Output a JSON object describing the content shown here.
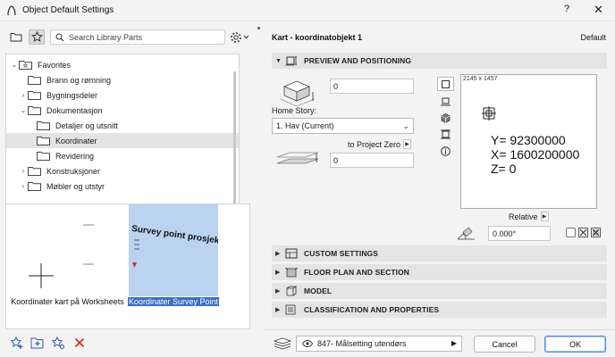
{
  "window": {
    "title": "Object Default Settings",
    "help": "?",
    "close": "✕"
  },
  "library": {
    "search_placeholder": "Search Library Parts",
    "tree": [
      {
        "label": "Favorites",
        "level": 0,
        "expanded": true,
        "type": "favorites"
      },
      {
        "label": "Brann og rømning",
        "level": 1,
        "expanded": false,
        "has_children": false
      },
      {
        "label": "Bygningsdeler",
        "level": 1,
        "expanded": false,
        "has_children": true
      },
      {
        "label": "Dokumentasjon",
        "level": 1,
        "expanded": true,
        "has_children": true
      },
      {
        "label": "Detaljer og utsnitt",
        "level": 2,
        "has_children": false
      },
      {
        "label": "Koordinater",
        "level": 2,
        "has_children": false,
        "selected": true
      },
      {
        "label": "Revidering",
        "level": 2,
        "has_children": false
      },
      {
        "label": "Konstruksjoner",
        "level": 1,
        "expanded": false,
        "has_children": true
      },
      {
        "label": "Møbler og utstyr",
        "level": 1,
        "expanded": false,
        "has_children": true
      }
    ],
    "items": [
      {
        "caption": "Koordinater kart på Worksheets",
        "selected": false
      },
      {
        "caption": "Koordinater Survey Point",
        "selected": true,
        "thumb_text": "Survey point prosjekt"
      }
    ]
  },
  "object": {
    "name": "Kart - koordinatobjekt 1",
    "default_label": "Default"
  },
  "sections": {
    "preview": "PREVIEW AND POSITIONING",
    "custom": "CUSTOM SETTINGS",
    "floorplan": "FLOOR PLAN AND SECTION",
    "model": "MODEL",
    "classification": "CLASSIFICATION AND PROPERTIES"
  },
  "positioning": {
    "elevation_value": "0",
    "home_story_label": "Home Story:",
    "home_story_value": "1. Hav (Current)",
    "to_project_zero": "to Project Zero",
    "project_zero_value": "0",
    "relative_label": "Relative",
    "angle_value": "0.000°"
  },
  "preview": {
    "dims": "2145 x 1457",
    "coord_y": "Y= 92300000",
    "coord_x": "X= 1600200000",
    "coord_z": "Z= 0"
  },
  "footer": {
    "layer": "847- Målsetting utendørs",
    "cancel": "Cancel",
    "ok": "OK"
  },
  "colors": {
    "accent": "#3b6fc4",
    "delete": "#d93025",
    "panel": "#e4e4e4",
    "thumb_bg": "#b9d3f0"
  }
}
